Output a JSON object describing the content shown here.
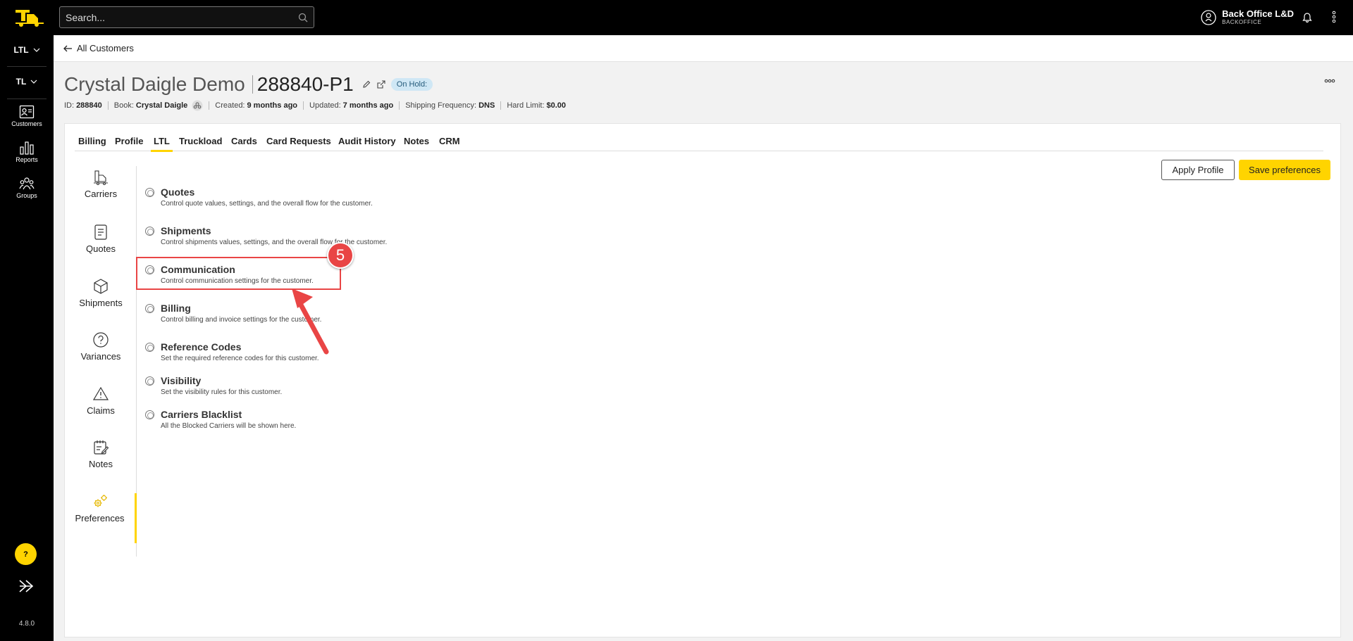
{
  "topbar": {
    "search_placeholder": "Search...",
    "user_name": "Back Office L&D",
    "user_role": "BACKOFFICE"
  },
  "rail": {
    "modes": [
      "LTL",
      "TL"
    ],
    "items": [
      {
        "label": "Customers",
        "icon": "customers-icon"
      },
      {
        "label": "Reports",
        "icon": "reports-icon"
      },
      {
        "label": "Groups",
        "icon": "groups-icon"
      }
    ],
    "help_label": "?",
    "version": "4.8.0"
  },
  "breadcrumb": {
    "back_label": "All Customers"
  },
  "header": {
    "customer_name": "Crystal Daigle Demo",
    "customer_id": "288840-P1",
    "status_badge": "On Hold:",
    "meta": {
      "id_label": "ID:",
      "id_value": "288840",
      "book_label": "Book:",
      "book_value": "Crystal Daigle",
      "created_label": "Created:",
      "created_value": "9 months ago",
      "updated_label": "Updated:",
      "updated_value": "7 months ago",
      "freq_label": "Shipping Frequency:",
      "freq_value": "DNS",
      "limit_label": "Hard Limit:",
      "limit_value": "$0.00"
    }
  },
  "tabs": [
    "Billing",
    "Profile",
    "LTL",
    "Truckload",
    "Cards",
    "Card Requests",
    "Audit History",
    "Notes",
    "CRM"
  ],
  "active_tab": "LTL",
  "subnav": [
    "Carriers",
    "Quotes",
    "Shipments",
    "Variances",
    "Claims",
    "Notes",
    "Preferences"
  ],
  "active_subnav": "Preferences",
  "buttons": {
    "apply": "Apply Profile",
    "save": "Save preferences"
  },
  "options": [
    {
      "title": "Quotes",
      "desc": "Control quote values, settings, and the overall flow for the customer."
    },
    {
      "title": "Shipments",
      "desc": "Control shipments values, settings, and the overall flow for the customer."
    },
    {
      "title": "Communication",
      "desc": "Control communication settings for the customer."
    },
    {
      "title": "Billing",
      "desc": "Control billing and invoice settings for the customer."
    },
    {
      "title": "Reference Codes",
      "desc": "Set the required reference codes for this customer."
    },
    {
      "title": "Visibility",
      "desc": "Set the visibility rules for this customer."
    },
    {
      "title": "Carriers Blacklist",
      "desc": "All the Blocked Carriers will be shown here."
    }
  ],
  "annotation": {
    "step": "5"
  },
  "colors": {
    "accent": "#ffd400",
    "annotation": "#e94545",
    "badge_bg": "#cfe7f5"
  }
}
